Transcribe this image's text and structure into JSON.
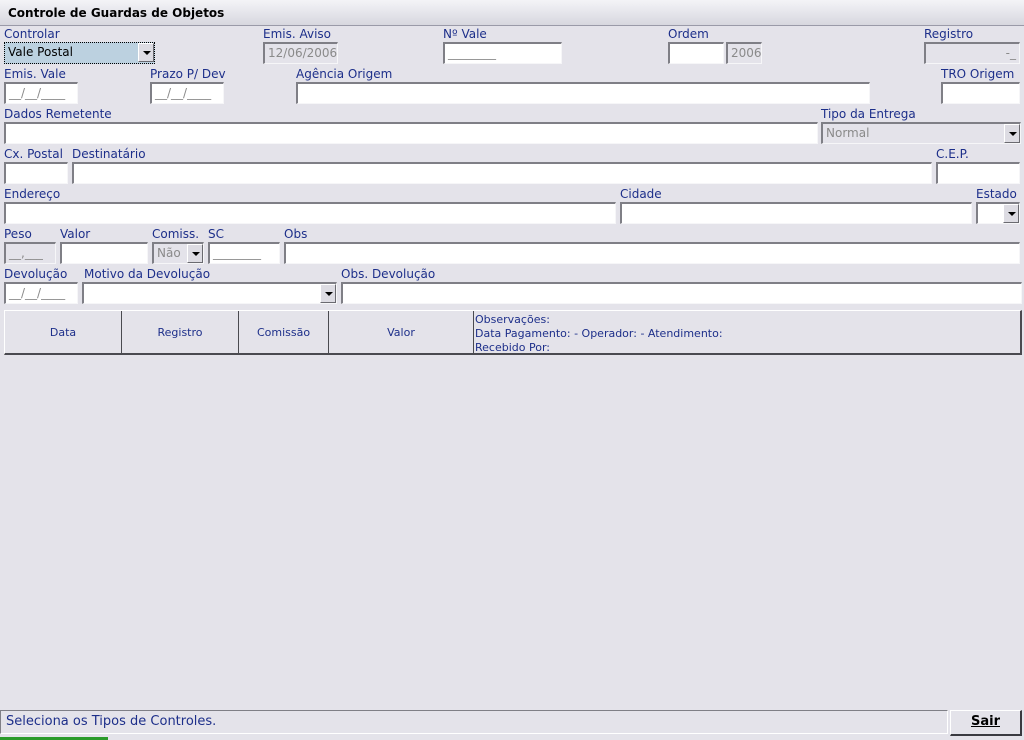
{
  "window": {
    "title": "Controle de Guardas de Objetos"
  },
  "form": {
    "controlar": {
      "label": "Controlar",
      "value": "Vale Postal"
    },
    "emis_aviso": {
      "label": "Emis. Aviso",
      "value": "12/06/2006"
    },
    "n_vale": {
      "label": "Nº Vale",
      "value": "________"
    },
    "ordem": {
      "label": "Ordem",
      "value": "",
      "year": "2006"
    },
    "registro": {
      "label": "Registro",
      "value": "-_"
    },
    "emis_vale": {
      "label": "Emis. Vale",
      "value": "__/__/____"
    },
    "prazo_dev": {
      "label": "Prazo P/ Dev",
      "value": "__/__/____"
    },
    "agencia_origem": {
      "label": "Agência Origem",
      "value": ""
    },
    "tro_origem": {
      "label": "TRO Origem",
      "value": ""
    },
    "dados_remetente": {
      "label": "Dados Remetente",
      "value": ""
    },
    "tipo_entrega": {
      "label": "Tipo da Entrega",
      "value": "Normal"
    },
    "cx_postal": {
      "label": "Cx. Postal",
      "value": ""
    },
    "destinatario": {
      "label": "Destinatário",
      "value": ""
    },
    "cep": {
      "label": "C.E.P.",
      "value": ""
    },
    "endereco": {
      "label": "Endereço",
      "value": ""
    },
    "cidade": {
      "label": "Cidade",
      "value": ""
    },
    "estado": {
      "label": "Estado",
      "value": ""
    },
    "peso": {
      "label": "Peso",
      "value": "__,___"
    },
    "valor": {
      "label": "Valor",
      "value": ""
    },
    "comiss": {
      "label": "Comiss.",
      "value": "Não"
    },
    "sc": {
      "label": "SC",
      "value": "________"
    },
    "obs": {
      "label": "Obs",
      "value": ""
    },
    "devolucao": {
      "label": "Devolução",
      "value": "__/__/____"
    },
    "motivo_devolucao": {
      "label": "Motivo da Devolução",
      "value": ""
    },
    "obs_devolucao": {
      "label": "Obs. Devolução",
      "value": ""
    }
  },
  "grid": {
    "columns": [
      "Data",
      "Registro",
      "Comissão",
      "Valor"
    ],
    "obs_lines": [
      "Observações:",
      "Data Pagamento:  -  Operador:  -  Atendimento:",
      "Recebido Por:"
    ]
  },
  "status": {
    "text": "Seleciona os Tipos de Controles."
  },
  "buttons": {
    "sair": "Sair"
  }
}
